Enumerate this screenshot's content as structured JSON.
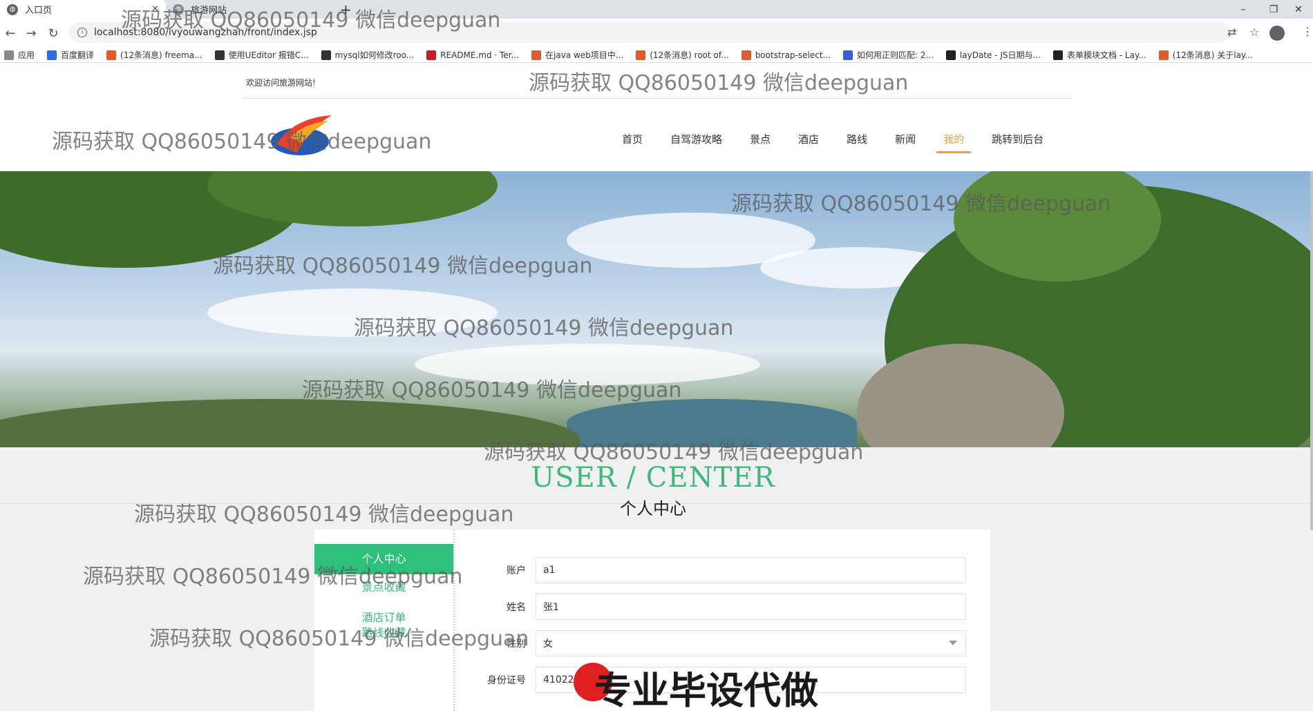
{
  "browser": {
    "tabs": [
      {
        "title": "入口页",
        "active": true
      },
      {
        "title": "旅游网站",
        "active": false
      }
    ],
    "new_tab": "+",
    "url": "localhost:8080/lvyouwangzhan/front/index.jsp",
    "window_controls": {
      "minimize": "–",
      "restore": "❐",
      "close": "✕"
    },
    "bookmarks": [
      {
        "label": "应用",
        "color": "#888888"
      },
      {
        "label": "百度翻译",
        "color": "#2b6de5"
      },
      {
        "label": "(12条消息) freema...",
        "color": "#e05a2b"
      },
      {
        "label": "使用UEditor 报错C...",
        "color": "#333333"
      },
      {
        "label": "mysql如何修改roo...",
        "color": "#333333"
      },
      {
        "label": "README.md · Ter...",
        "color": "#c71d23"
      },
      {
        "label": "在java web项目中...",
        "color": "#e05a2b"
      },
      {
        "label": "(12条消息) root of...",
        "color": "#e05a2b"
      },
      {
        "label": "bootstrap-select...",
        "color": "#e05a2b"
      },
      {
        "label": "如何用正则匹配: 2...",
        "color": "#3a5bd9"
      },
      {
        "label": "layDate - JS日期与...",
        "color": "#222222"
      },
      {
        "label": "表单模块文档 - Lay...",
        "color": "#222222"
      },
      {
        "label": "(12条消息) 关于lay...",
        "color": "#e05a2b"
      }
    ]
  },
  "header": {
    "welcome": "欢迎访问旅游网站!",
    "nav": [
      {
        "label": "首页",
        "active": false
      },
      {
        "label": "自驾游攻略",
        "active": false
      },
      {
        "label": "景点",
        "active": false
      },
      {
        "label": "酒店",
        "active": false
      },
      {
        "label": "路线",
        "active": false
      },
      {
        "label": "新闻",
        "active": false
      },
      {
        "label": "我的",
        "active": true
      },
      {
        "label": "跳转到后台",
        "active": false
      }
    ]
  },
  "section": {
    "title_en": "USER / CENTER",
    "title_cn": "个人中心"
  },
  "sidebar": {
    "items": [
      {
        "label": "个人中心",
        "active": true
      },
      {
        "label": "景点收藏",
        "active": false
      },
      {
        "label": "酒店订单",
        "active": false
      },
      {
        "label": "路线收藏",
        "active": false
      }
    ]
  },
  "form": {
    "account": {
      "label": "账户",
      "value": "a1"
    },
    "name": {
      "label": "姓名",
      "value": "张1"
    },
    "gender": {
      "label": "性别",
      "value": "女"
    },
    "id_card": {
      "label": "身份证号",
      "value": "41022"
    }
  },
  "overlays": {
    "watermark": "源码获取 QQ86050149 微信deepguan",
    "promo": "专业毕设代做"
  },
  "colors": {
    "accent_green": "#2ec07a",
    "nav_active": "#e6a23c"
  }
}
